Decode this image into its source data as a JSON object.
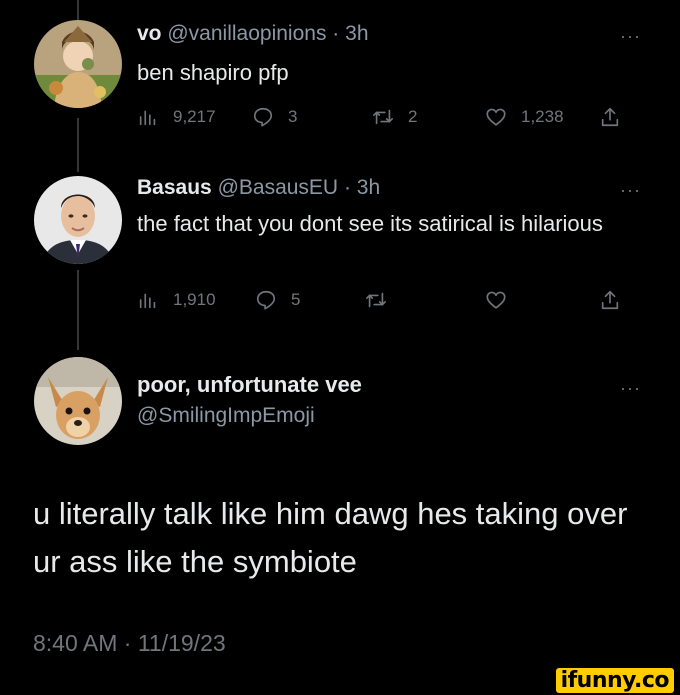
{
  "colors": {
    "background": "#000000",
    "text": "#e7e9ea",
    "muted": "#71767b",
    "thread_line": "#333639",
    "watermark_bg": "#ffcc00"
  },
  "tweets": [
    {
      "name": "vo",
      "handle": "@vanillaopinions",
      "separator": "·",
      "time": "3h",
      "text": "ben shapiro pfp",
      "views": "9,217",
      "replies": "3",
      "retweets": "2",
      "likes": "1,238"
    },
    {
      "name": "Basaus",
      "handle": "@BasausEU",
      "separator": "·",
      "time": "3h",
      "text": "the fact that you dont see its satirical is hilarious",
      "views": "1,910",
      "replies": "5"
    }
  ],
  "main": {
    "name": "poor, unfortunate vee",
    "handle": "@SmilingImpEmoji",
    "text": "u literally talk like him dawg hes taking over ur ass like the symbiote",
    "timestamp": "8:40 AM · 11/19/23"
  },
  "more_glyph": "···",
  "watermark": "ifunny.co",
  "icons": [
    "views-icon",
    "reply-icon",
    "retweet-icon",
    "like-icon",
    "share-icon",
    "more-icon"
  ]
}
